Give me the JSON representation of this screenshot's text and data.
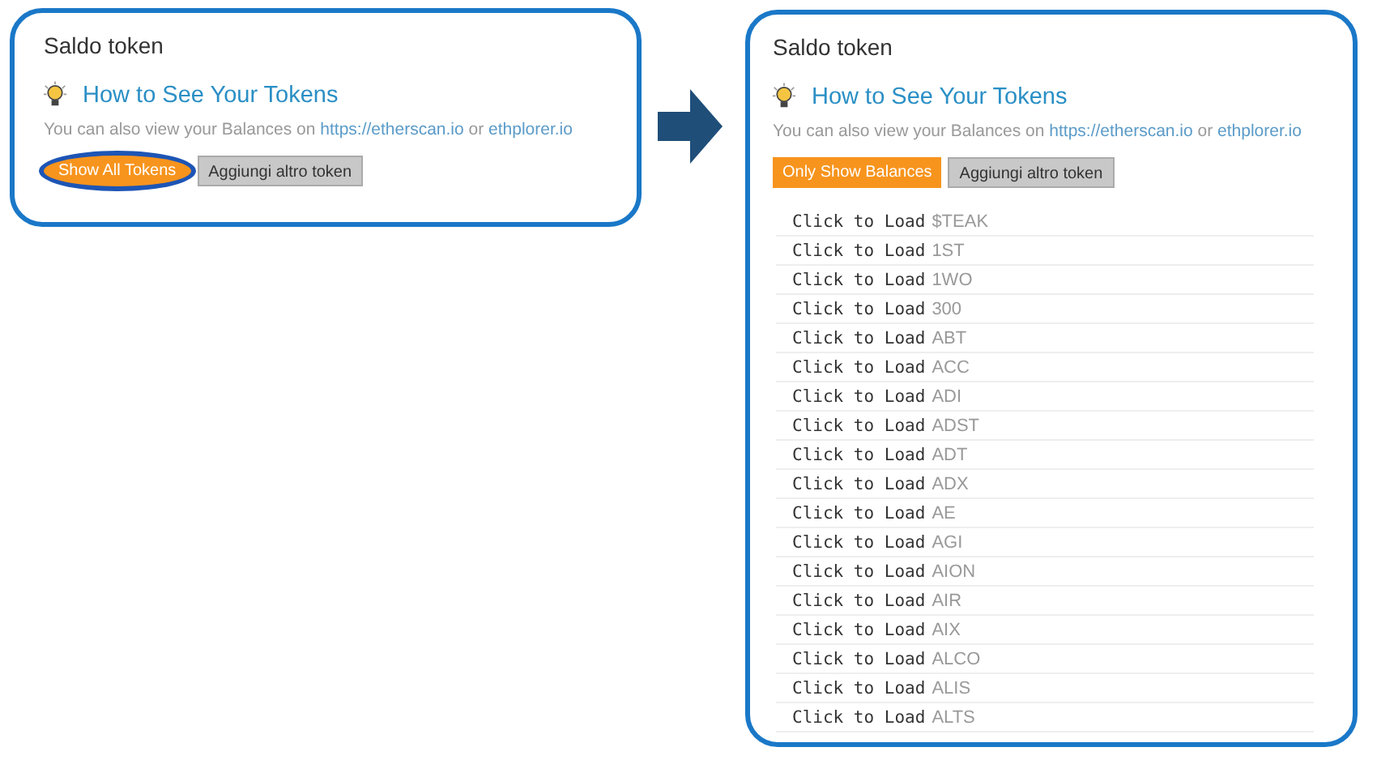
{
  "panels": [
    {
      "title": "Saldo token",
      "tip": "How to See Your Tokens",
      "info": [
        {
          "kind": "text",
          "text": "You can also view your Balances on "
        },
        {
          "kind": "link",
          "text": "https://etherscan.io"
        },
        {
          "kind": "text",
          "text": " or "
        },
        {
          "kind": "link",
          "text": "ethplorer.io"
        }
      ],
      "buttons": [
        {
          "label": "Show All Tokens",
          "kind": "primary",
          "circled": true
        },
        {
          "label": "Aggiungi altro token",
          "kind": "secondary",
          "circled": false
        }
      ]
    },
    {
      "title": "Saldo token",
      "tip": "How to See Your Tokens",
      "info": [
        {
          "kind": "text",
          "text": "You can also view your Balances on "
        },
        {
          "kind": "link",
          "text": "https://etherscan.io"
        },
        {
          "kind": "text",
          "text": " or "
        },
        {
          "kind": "link",
          "text": "ethplorer.io"
        }
      ],
      "buttons": [
        {
          "label": "Only Show Balances",
          "kind": "primary",
          "circled": false
        },
        {
          "label": "Aggiungi altro token",
          "kind": "secondary",
          "circled": false
        }
      ],
      "tokens": [
        {
          "action": "Click to Load",
          "symbol": "$TEAK"
        },
        {
          "action": "Click to Load",
          "symbol": "1ST"
        },
        {
          "action": "Click to Load",
          "symbol": "1WO"
        },
        {
          "action": "Click to Load",
          "symbol": "300"
        },
        {
          "action": "Click to Load",
          "symbol": "ABT"
        },
        {
          "action": "Click to Load",
          "symbol": "ACC"
        },
        {
          "action": "Click to Load",
          "symbol": "ADI"
        },
        {
          "action": "Click to Load",
          "symbol": "ADST"
        },
        {
          "action": "Click to Load",
          "symbol": "ADT"
        },
        {
          "action": "Click to Load",
          "symbol": "ADX"
        },
        {
          "action": "Click to Load",
          "symbol": "AE"
        },
        {
          "action": "Click to Load",
          "symbol": "AGI"
        },
        {
          "action": "Click to Load",
          "symbol": "AION"
        },
        {
          "action": "Click to Load",
          "symbol": "AIR"
        },
        {
          "action": "Click to Load",
          "symbol": "AIX"
        },
        {
          "action": "Click to Load",
          "symbol": "ALCO"
        },
        {
          "action": "Click to Load",
          "symbol": "ALIS"
        },
        {
          "action": "Click to Load",
          "symbol": "ALTS"
        }
      ]
    }
  ]
}
